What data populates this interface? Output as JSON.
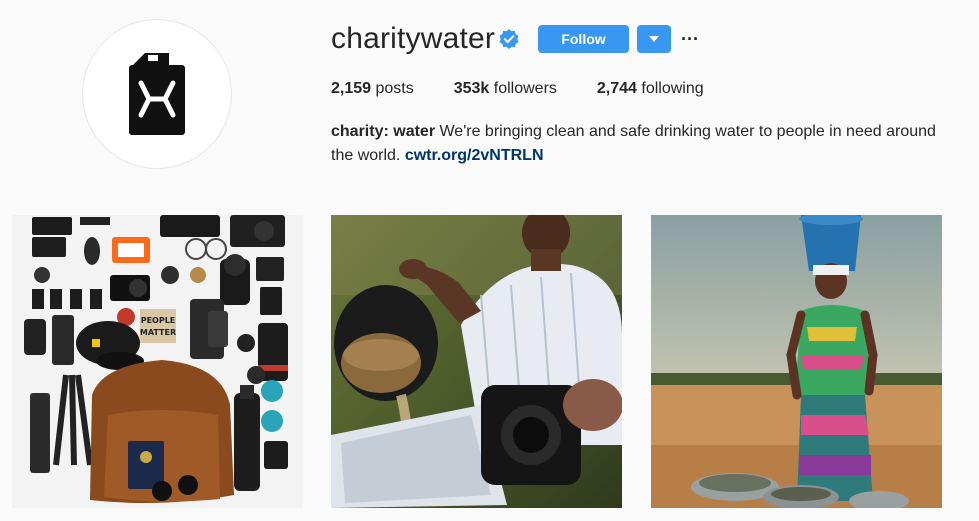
{
  "profile": {
    "username": "charitywater",
    "follow_label": "Follow",
    "more_label": "···"
  },
  "stats": {
    "posts_count": "2,159",
    "posts_label": " posts",
    "followers_count": "353k",
    "followers_label": " followers",
    "following_count": "2,744",
    "following_label": " following"
  },
  "bio": {
    "name": "charity: water",
    "text": " We're bringing clean and safe drinking water to people in need around the world. ",
    "link": "cwtr.org/2vNTRLN"
  },
  "post1": {
    "patch_text_1": "PEOPLE",
    "patch_text_2": "MATTER"
  },
  "colors": {
    "accent": "#3897f0",
    "link": "#003569",
    "verified": "#3897f0"
  },
  "icons": [
    "verified-badge-icon",
    "chevron-down-icon",
    "more-options-icon",
    "jerrycan-logo-icon"
  ]
}
